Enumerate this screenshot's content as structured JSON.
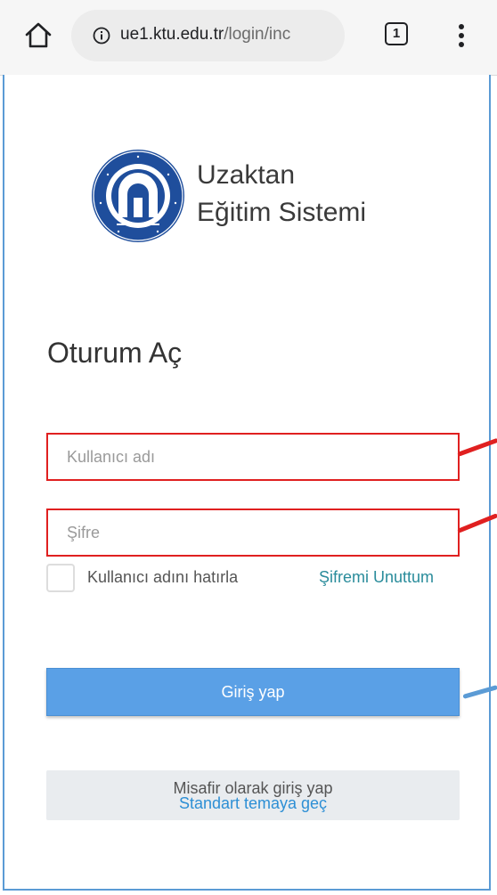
{
  "browser": {
    "url_host": "ue1.ktu.edu.tr",
    "url_path": "/login/inc",
    "tab_count": "1",
    "icons": [
      "home-icon",
      "info-icon",
      "tabs-icon",
      "more-vert-icon"
    ]
  },
  "brand": {
    "logo_icon": "ktu-seal-icon",
    "line1": "Uzaktan",
    "line2": "Eğitim Sistemi"
  },
  "login": {
    "title": "Oturum Aç",
    "username_placeholder": "Kullanıcı adı",
    "password_placeholder": "Şifre",
    "remember_label": "Kullanıcı adını hatırla",
    "remember_checked": false,
    "forgot_link": "Şifremi Unuttum",
    "submit_label": "Giriş yap",
    "guest_label": "Misafir olarak giriş yap",
    "theme_link": "Standart temaya geç"
  },
  "colors": {
    "primary_button": "#5aa0e6",
    "link": "#2a8c9b",
    "highlight_box": "#e02020",
    "annotation_red": "#e02020",
    "annotation_blue": "#5b9bd5"
  }
}
